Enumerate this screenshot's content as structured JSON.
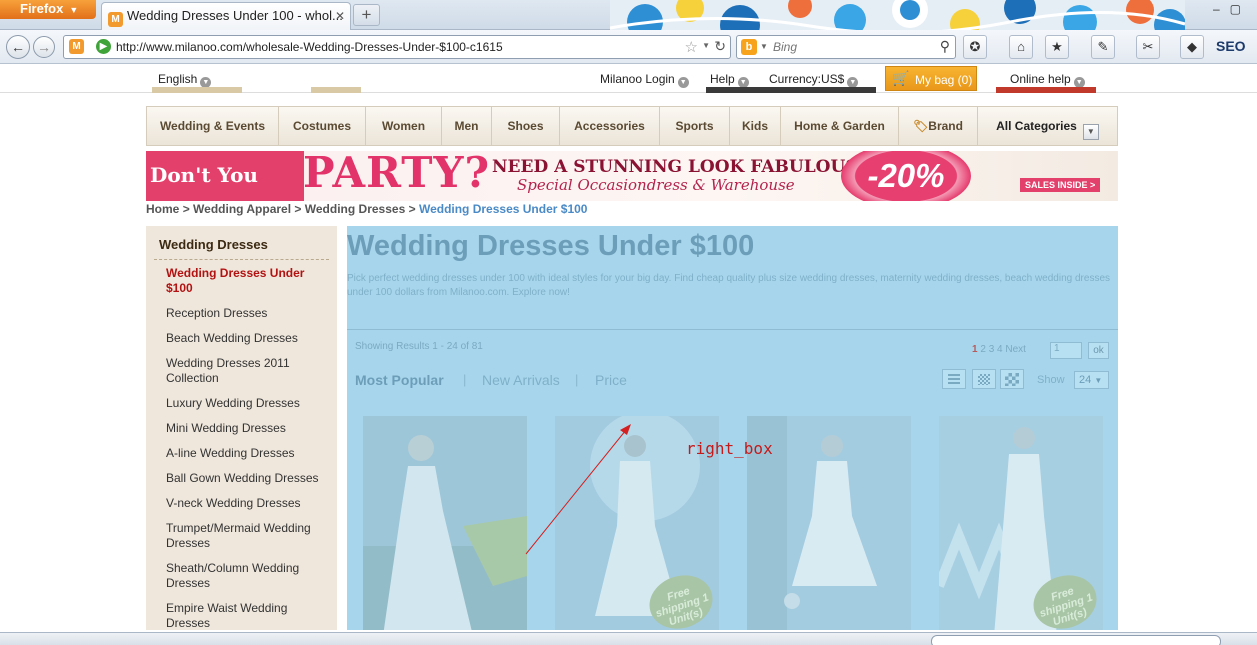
{
  "browser": {
    "app_button": "Firefox",
    "tab_title": "Wedding Dresses Under 100 - whol...",
    "new_tab_symbol": "+",
    "url": "http://www.milanoo.com/wholesale-Wedding-Dresses-Under-$100-c1615",
    "search_placeholder": "Bing",
    "toolbar_label_seo": "SEO"
  },
  "site_top": {
    "language": "English",
    "login": "Milanoo Login",
    "help": "Help",
    "currency": "Currency:US$",
    "bag": "My bag (0)",
    "online_help": "Online help"
  },
  "main_nav": {
    "items": [
      "Wedding & Events",
      "Costumes",
      "Women",
      "Men",
      "Shoes",
      "Accessories",
      "Sports",
      "Kids",
      "Home & Garden",
      "Brand"
    ],
    "all_categories": "All Categories"
  },
  "banner": {
    "dont": "Don't You Like",
    "party": "PARTY?",
    "headline": "NEED A STUNNING LOOK FABULOUS",
    "sub": "Special Occasiondress & Warehouse",
    "discount": "-20%",
    "sales": "SALES INSIDE >"
  },
  "breadcrumb": {
    "home": "Home",
    "l1": "Wedding Apparel",
    "l2": "Wedding Dresses",
    "current": "Wedding Dresses Under $100",
    "sep": ">"
  },
  "sidebar": {
    "title": "Wedding Dresses",
    "items": [
      "Wedding Dresses Under $100",
      "Reception Dresses",
      "Beach Wedding Dresses",
      "Wedding Dresses 2011 Collection",
      "Luxury Wedding Dresses",
      "Mini Wedding Dresses",
      "A-line Wedding Dresses",
      "Ball Gown Wedding Dresses",
      "V-neck Wedding Dresses",
      "Trumpet/Mermaid Wedding Dresses",
      "Sheath/Column Wedding Dresses",
      "Empire Waist Wedding Dresses"
    ]
  },
  "content": {
    "title": "Wedding Dresses Under $100",
    "description": "Pick perfect wedding dresses under 100 with ideal styles for your big day. Find cheap quality plus size wedding dresses, maternity wedding dresses, beach wedding dresses under 100 dollars from Milanoo.com. Explore now!",
    "results": "Showing Results 1 - 24 of 81",
    "pages": [
      "1",
      "2",
      "3",
      "4"
    ],
    "next": "Next",
    "page_value": "1",
    "ok": "ok",
    "sort": {
      "popular": "Most Popular",
      "arrivals": "New Arrivals",
      "price": "Price",
      "sep": "|"
    },
    "show_label": "Show",
    "show_value": "24",
    "free_shipping": "Free shipping 1 Unit(s)"
  },
  "annotation": {
    "label": "right_box"
  },
  "colors": {
    "overlay": "#a7d6ec",
    "accent_red": "#b31212",
    "bag_orange": "#f0a227",
    "nav_text": "#5b4a32"
  }
}
